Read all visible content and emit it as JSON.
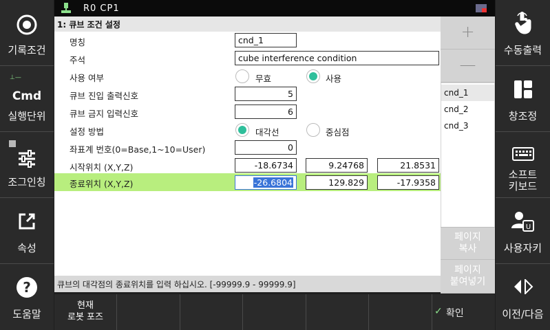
{
  "status_bar": {
    "text": "R0   CP1"
  },
  "left_sidebar": {
    "record": {
      "label": "기록조건"
    },
    "unit": {
      "icon_text": "Cmd",
      "label": "실행단위"
    },
    "jog": {
      "label": "조그인칭"
    },
    "props": {
      "label": "속성"
    },
    "help": {
      "label": "도움말"
    }
  },
  "right_sidebar": {
    "manual_output": {
      "label": "수동출력"
    },
    "windows": {
      "label": "창조정"
    },
    "softkb": {
      "label1": "소프트",
      "label2": "키보드"
    },
    "user_key": {
      "label": "사용자키"
    },
    "prevnext": {
      "label": "이전/다음"
    }
  },
  "form": {
    "title": "1: 큐브 조건 설정",
    "name": {
      "label": "명칭",
      "value": "cnd_1"
    },
    "comment": {
      "label": "주석",
      "value": "cube interference condition"
    },
    "use": {
      "label": "사용 여부",
      "options": [
        "무효",
        "사용"
      ],
      "selected": "사용"
    },
    "enter_out": {
      "label": "큐브 진입 출력신호",
      "value": "5"
    },
    "forbid_in": {
      "label": "큐브 금지 입력신호",
      "value": "6"
    },
    "method": {
      "label": "설정 방법",
      "options": [
        "대각선",
        "중심점"
      ],
      "selected": "대각선"
    },
    "coord": {
      "label": "좌표계 번호(0=Base,1~10=User)",
      "value": "0"
    },
    "start": {
      "label": "시작위치 (X,Y,Z)",
      "x": "-18.6734",
      "y": "9.24768",
      "z": "21.8531"
    },
    "end": {
      "label": "종료위치 (X,Y,Z)",
      "x": "-26.6804",
      "y": "129.829",
      "z": "-17.9358"
    }
  },
  "hint": "큐브의 대각점의 종료위치를 입력 하십시오. [-99999.9 - 99999.9]",
  "panel": {
    "add": "+",
    "remove": "—",
    "list": [
      "cnd_1",
      "cnd_2",
      "cnd_3"
    ],
    "selected": "cnd_1",
    "page_copy": [
      "페이지",
      "복사"
    ],
    "page_paste": [
      "페이지",
      "붙여넣기"
    ]
  },
  "bottom_bar": {
    "robot_pose": [
      "현재",
      "로봇 포즈"
    ],
    "confirm": "확인"
  }
}
